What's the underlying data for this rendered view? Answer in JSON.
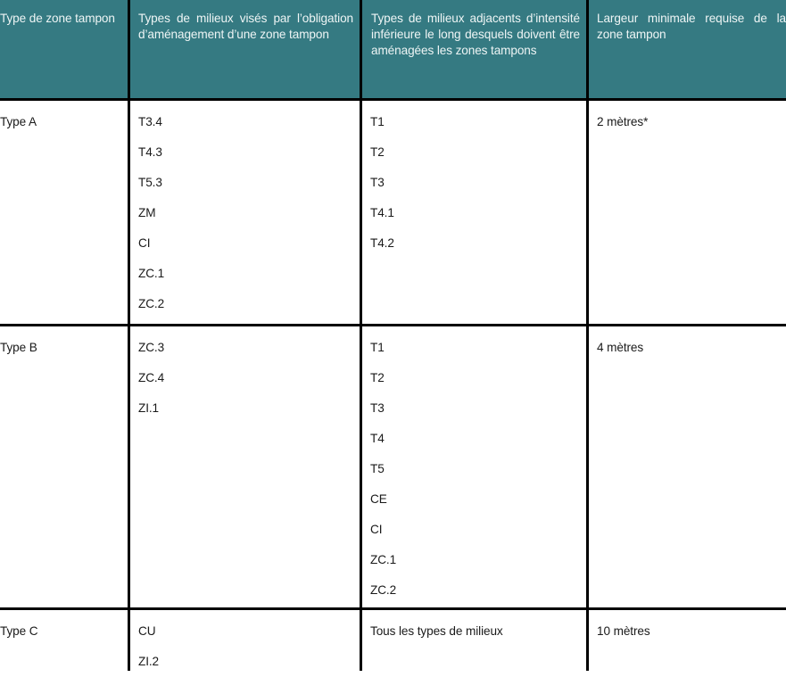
{
  "table": {
    "header_color": "#357A82",
    "headers": [
      "Type de zone tampon",
      "Types de milieux visés par l’obligation d’aménagement d’une zone tampon",
      "Types de milieux adjacents d’intensité inférieure le long desquels doivent être aménagées les zones tampons",
      "Largeur minimale requise de la zone tampon"
    ],
    "rows": [
      {
        "type": "Type A",
        "milieux_vises": [
          "T3.4",
          "T4.3",
          "T5.3",
          "ZM",
          "CI",
          "ZC.1",
          "ZC.2"
        ],
        "milieux_adjacents": [
          "T1",
          "T2",
          "T3",
          "T4.1",
          "T4.2"
        ],
        "largeur": "2 mètres*"
      },
      {
        "type": "Type B",
        "milieux_vises": [
          "ZC.3",
          "ZC.4",
          "ZI.1"
        ],
        "milieux_adjacents": [
          "T1",
          "T2",
          "T3",
          "T4",
          "T5",
          "CE",
          "CI",
          "ZC.1",
          "ZC.2"
        ],
        "largeur": "4 mètres"
      },
      {
        "type": "Type C",
        "milieux_vises": [
          "CU",
          "ZI.2"
        ],
        "milieux_adjacents": [
          "Tous les types de milieux"
        ],
        "largeur": "10 mètres"
      }
    ]
  }
}
